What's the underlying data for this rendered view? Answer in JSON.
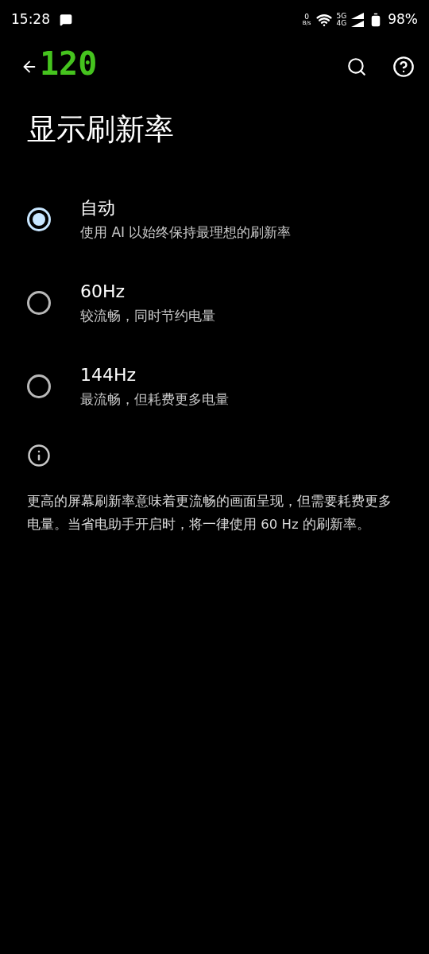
{
  "status_bar": {
    "time": "15:28",
    "net_speed": "0",
    "net_unit": "B/s",
    "network_top": "5G",
    "network_bottom": "4G",
    "battery": "98%"
  },
  "fps_overlay": "120",
  "title": "显示刷新率",
  "options": [
    {
      "label": "自动",
      "description": "使用 AI 以始终保持最理想的刷新率",
      "selected": true
    },
    {
      "label": "60Hz",
      "description": "较流畅，同时节约电量",
      "selected": false
    },
    {
      "label": "144Hz",
      "description": "最流畅，但耗费更多电量",
      "selected": false
    }
  ],
  "info": "更高的屏幕刷新率意味着更流畅的画面呈现，但需要耗费更多电量。当省电助手开启时，将一律使用 60 Hz 的刷新率。"
}
